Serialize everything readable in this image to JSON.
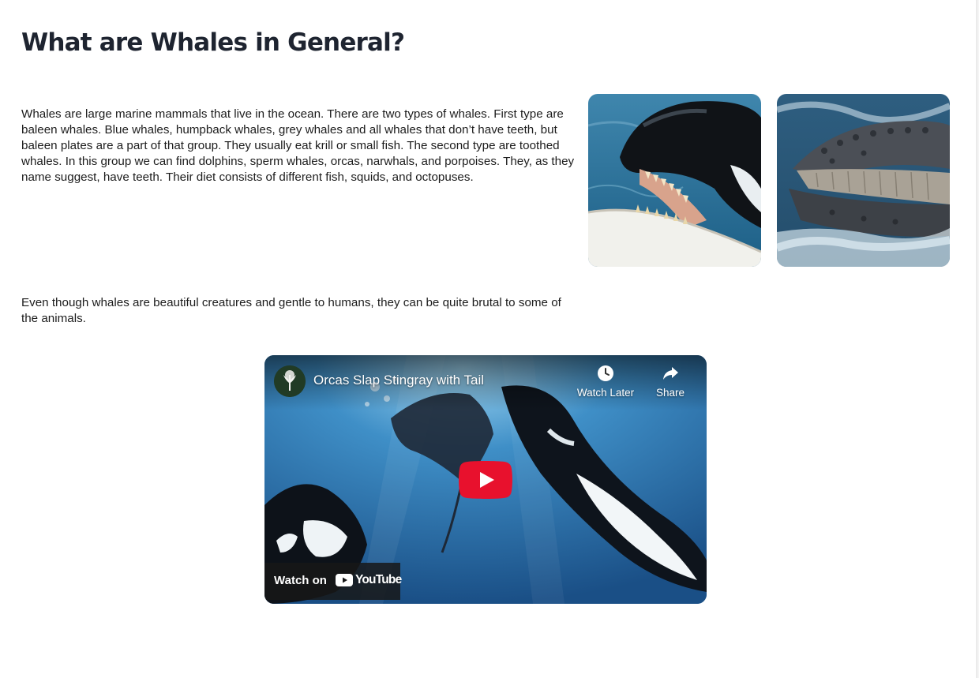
{
  "section": {
    "title": "What are Whales in General?",
    "paragraph_1": "Whales are large marine mammals that live in the ocean. There are two types of whales. First type are baleen whales. Blue whales, humpback whales, grey whales and all whales that don’t have teeth, but baleen plates are a part of that group. They usually eat krill or small fish. The second type are toothed whales. In this group we can find dolphins, sperm whales, orcas, narwhals, and porpoises. They, as they name suggest, have teeth. Their diet consists of different fish, squids, and octopuses.",
    "paragraph_2": "Even though whales are beautiful creatures and gentle to humans, they can be quite brutal to some of the animals."
  },
  "images": [
    {
      "subject": "orca with open mouth showing teeth",
      "icon": "orca-photo"
    },
    {
      "subject": "humpback whale with open mouth showing baleen",
      "icon": "humpback-photo"
    }
  ],
  "video": {
    "title": "Orcas Slap Stingray with Tail",
    "watch_later_label": "Watch Later",
    "share_label": "Share",
    "watch_on_label": "Watch on",
    "platform_name": "YouTube",
    "colors": {
      "play_red": "#ff0000",
      "overlay": "#171717"
    }
  }
}
